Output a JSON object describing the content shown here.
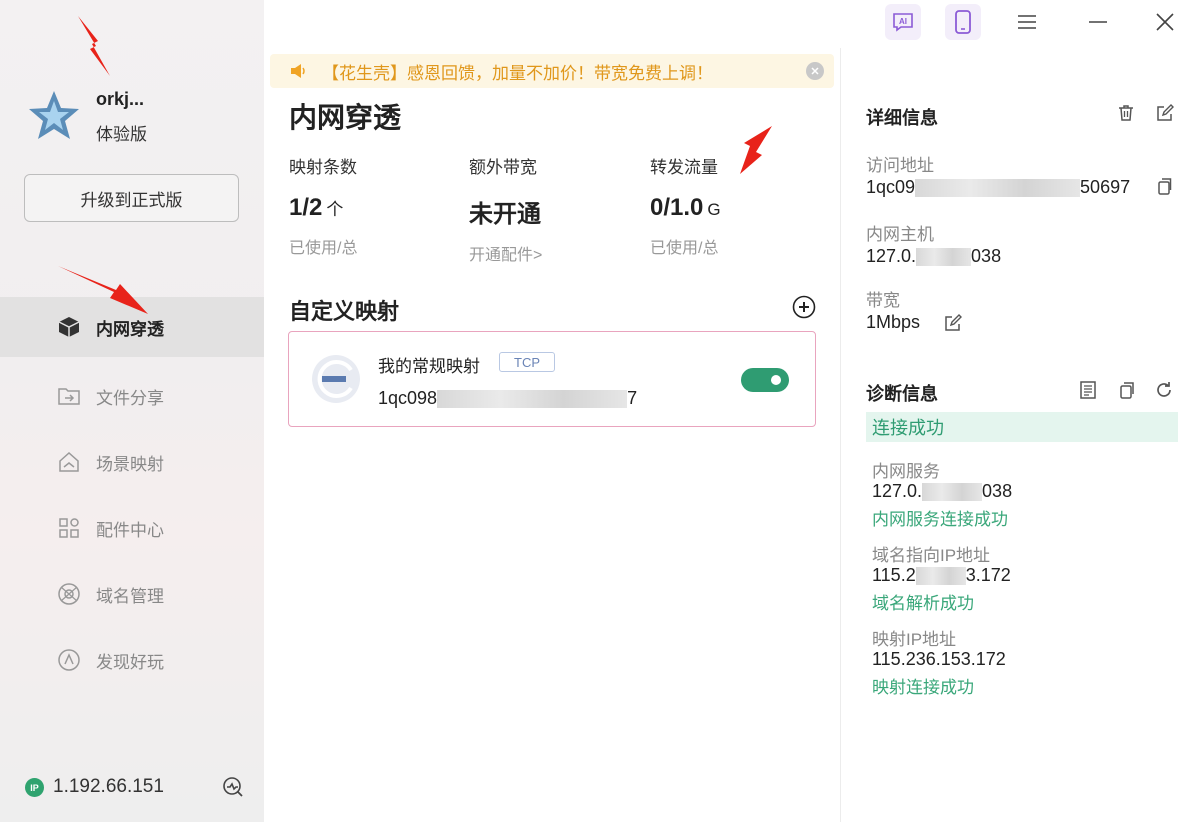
{
  "user": {
    "name": "orkj...",
    "plan": "体验版",
    "upgrade_label": "升级到正式版"
  },
  "nav": {
    "items": [
      {
        "label": "内网穿透",
        "icon": "cube-icon",
        "active": true
      },
      {
        "label": "文件分享",
        "icon": "folder-share-icon"
      },
      {
        "label": "场景映射",
        "icon": "home-map-icon"
      },
      {
        "label": "配件中心",
        "icon": "grid-apps-icon"
      },
      {
        "label": "域名管理",
        "icon": "globe-icon"
      },
      {
        "label": "发现好玩",
        "icon": "compass-icon"
      }
    ]
  },
  "footer": {
    "ip_badge": "IP",
    "ip": "1.192.66.151"
  },
  "titlebar": {
    "ai_label": "AI"
  },
  "notice": {
    "text": "【花生壳】感恩回馈，加量不加价！带宽免费上调！"
  },
  "main": {
    "title": "内网穿透",
    "stats": [
      {
        "label": "映射条数",
        "value": "1/2",
        "unit": "个",
        "sub": "已使用/总"
      },
      {
        "label": "额外带宽",
        "value": "未开通",
        "unit": "",
        "sub": "开通配件>"
      },
      {
        "label": "转发流量",
        "value": "0/1.0",
        "unit": "G",
        "sub": "已使用/总"
      }
    ],
    "section_title": "自定义映射",
    "mapping": {
      "name": "我的常规映射",
      "protocol": "TCP",
      "addr_prefix": "1qc098",
      "addr_suffix": "7",
      "enabled": true
    }
  },
  "details": {
    "title": "详细信息",
    "access_label": "访问地址",
    "access_prefix": "1qc09",
    "access_suffix": "50697",
    "host_label": "内网主机",
    "host_prefix": "127.0.",
    "host_suffix": "038",
    "bandwidth_label": "带宽",
    "bandwidth_value": "1Mbps"
  },
  "diagnosis": {
    "title": "诊断信息",
    "status": "连接成功",
    "service_label": "内网服务",
    "service_prefix": "127.0.",
    "service_suffix": "038",
    "service_ok": "内网服务连接成功",
    "dns_label": "域名指向IP地址",
    "dns_prefix": "115.2",
    "dns_suffix": "3.172",
    "dns_ok": "域名解析成功",
    "map_ip_label": "映射IP地址",
    "map_ip_value": "115.236.153.172",
    "map_ip_ok": "映射连接成功"
  },
  "colors": {
    "accent_green": "#2f9c72",
    "notice_orange": "#e0971b",
    "arrow_red": "#e8231a"
  }
}
